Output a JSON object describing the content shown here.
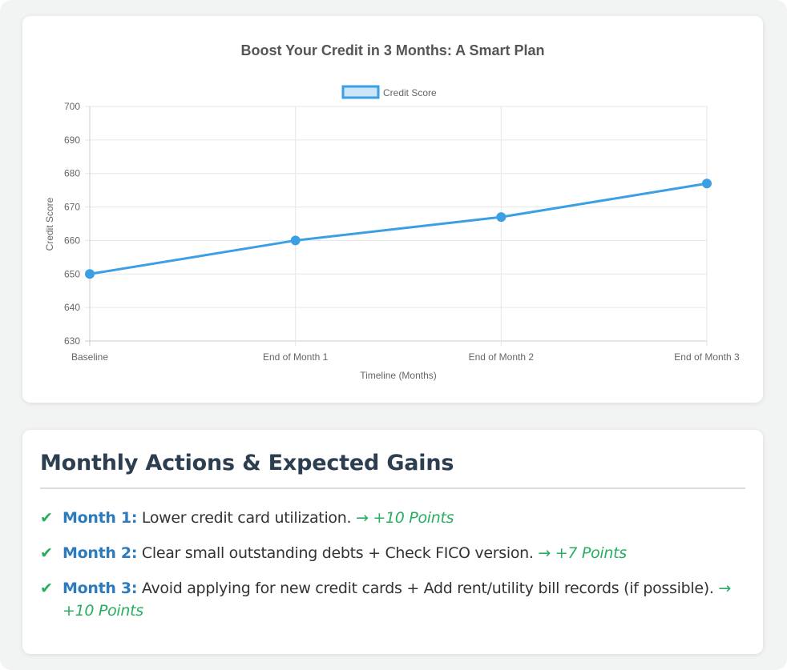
{
  "chart_data": {
    "type": "line",
    "title": "Boost Your Credit in 3 Months: A Smart Plan",
    "categories": [
      "Baseline",
      "End of Month 1",
      "End of Month 2",
      "End of Month 3"
    ],
    "series": [
      {
        "name": "Credit Score",
        "values": [
          650,
          660,
          667,
          677
        ]
      }
    ],
    "xlabel": "Timeline (Months)",
    "ylabel": "Credit Score",
    "ylim": [
      630,
      700
    ],
    "yticks": [
      630,
      640,
      650,
      660,
      670,
      680,
      690,
      700
    ],
    "grid": true,
    "legend": "top-center",
    "colors": {
      "line": "#3b9fe3",
      "legend_fill": "#cce6f7"
    }
  },
  "actions": {
    "title": "Monthly Actions & Expected Gains",
    "check_symbol": "✔",
    "items": [
      {
        "month": "Month 1:",
        "text": " Lower credit card utilization. ",
        "gain": "→ +10 Points"
      },
      {
        "month": "Month 2:",
        "text": " Clear small outstanding debts + Check FICO version. ",
        "gain": "→ +7 Points"
      },
      {
        "month": "Month 3:",
        "text": " Avoid applying for new credit cards + Add rent/utility bill records (if possible). ",
        "gain": "→ +10 Points"
      }
    ]
  }
}
